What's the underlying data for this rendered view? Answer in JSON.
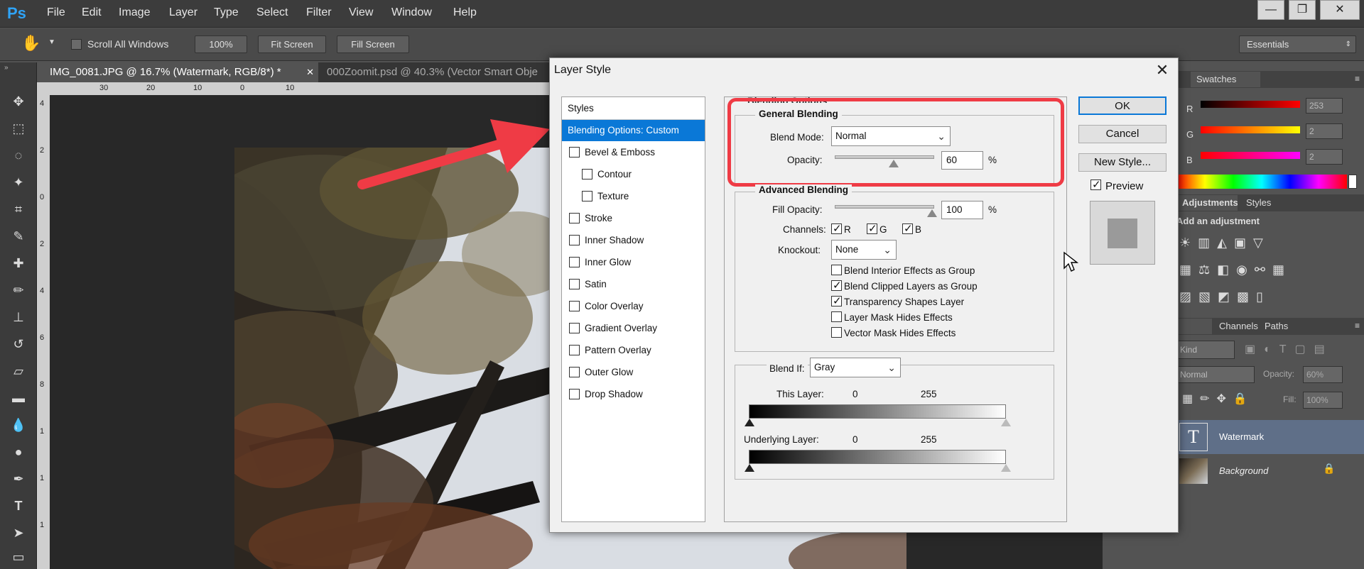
{
  "app": {
    "logo": "Ps"
  },
  "menu": [
    "File",
    "Edit",
    "Image",
    "Layer",
    "Type",
    "Select",
    "Filter",
    "View",
    "Window",
    "Help"
  ],
  "window_controls": {
    "minimize": "—",
    "restore": "❐",
    "close": "✕"
  },
  "options_bar": {
    "scroll_all_windows": "Scroll All Windows",
    "zoom_100": "100%",
    "fit_screen": "Fit Screen",
    "fill_screen": "Fill Screen",
    "workspace": "Essentials"
  },
  "tabs": [
    {
      "label": "IMG_0081.JPG @ 16.7% (Watermark, RGB/8*) *"
    },
    {
      "label": "000Zoomit.psd @ 40.3% (Vector Smart Obje"
    }
  ],
  "ruler_top": [
    "30",
    "20",
    "10",
    "0",
    "10"
  ],
  "ruler_left": [
    "4",
    "2",
    "0",
    "2",
    "4",
    "6",
    "8",
    "1",
    "1",
    "1"
  ],
  "right_panel": {
    "swatches_tab": "Swatches",
    "r_label": "R",
    "g_label": "G",
    "b_label": "B",
    "r_value": "253",
    "g_value": "2",
    "b_value": "2",
    "adjustments_tab": "Adjustments",
    "styles_tab": "Styles",
    "add_adjustment": "Add an adjustment",
    "channels_tab": "Channels",
    "paths_tab": "Paths",
    "kind": "Kind",
    "normal": "Normal",
    "opacity_label": "Opacity:",
    "opacity_value": "60%",
    "fill_label": "Fill:",
    "fill_value": "100%",
    "layers": [
      {
        "name": "Watermark",
        "thumb": "T"
      },
      {
        "name": "Background"
      }
    ]
  },
  "dialog": {
    "title": "Layer Style",
    "close": "✕",
    "styles_header": "Styles",
    "styles": [
      {
        "label": "Blending Options: Custom",
        "selected": true,
        "checkbox": false,
        "indent": false
      },
      {
        "label": "Bevel & Emboss",
        "checkbox": true,
        "indent": false
      },
      {
        "label": "Contour",
        "checkbox": true,
        "indent": true
      },
      {
        "label": "Texture",
        "checkbox": true,
        "indent": true
      },
      {
        "label": "Stroke",
        "checkbox": true,
        "indent": false
      },
      {
        "label": "Inner Shadow",
        "checkbox": true,
        "indent": false
      },
      {
        "label": "Inner Glow",
        "checkbox": true,
        "indent": false
      },
      {
        "label": "Satin",
        "checkbox": true,
        "indent": false
      },
      {
        "label": "Color Overlay",
        "checkbox": true,
        "indent": false
      },
      {
        "label": "Gradient Overlay",
        "checkbox": true,
        "indent": false
      },
      {
        "label": "Pattern Overlay",
        "checkbox": true,
        "indent": false
      },
      {
        "label": "Outer Glow",
        "checkbox": true,
        "indent": false
      },
      {
        "label": "Drop Shadow",
        "checkbox": true,
        "indent": false
      }
    ],
    "blending_options_title": "Blending Options",
    "general_blending": "General Blending",
    "blend_mode_label": "Blend Mode:",
    "blend_mode_value": "Normal",
    "opacity_label": "Opacity:",
    "opacity_value": "60",
    "opacity_fraction": 0.6,
    "percent": "%",
    "advanced_blending": "Advanced Blending",
    "fill_opacity_label": "Fill Opacity:",
    "fill_opacity_value": "100",
    "fill_opacity_fraction": 1.0,
    "channels_label": "Channels:",
    "channels": [
      {
        "label": "R",
        "checked": true
      },
      {
        "label": "G",
        "checked": true
      },
      {
        "label": "B",
        "checked": true
      }
    ],
    "knockout_label": "Knockout:",
    "knockout_value": "None",
    "options": [
      {
        "label": "Blend Interior Effects as Group",
        "checked": false
      },
      {
        "label": "Blend Clipped Layers as Group",
        "checked": true
      },
      {
        "label": "Transparency Shapes Layer",
        "checked": true
      },
      {
        "label": "Layer Mask Hides Effects",
        "checked": false
      },
      {
        "label": "Vector Mask Hides Effects",
        "checked": false
      }
    ],
    "blend_if_label": "Blend If:",
    "blend_if_value": "Gray",
    "this_layer_label": "This Layer:",
    "this_layer_min": "0",
    "this_layer_max": "255",
    "underlying_layer_label": "Underlying Layer:",
    "underlying_min": "0",
    "underlying_max": "255",
    "ok": "OK",
    "cancel": "Cancel",
    "new_style": "New Style...",
    "preview_label": "Preview",
    "preview_checked": true
  },
  "colors": {
    "annotation_red": "#ef3b45",
    "selected_blue": "#0a78d7",
    "ps_blue": "#2fa3f6"
  }
}
